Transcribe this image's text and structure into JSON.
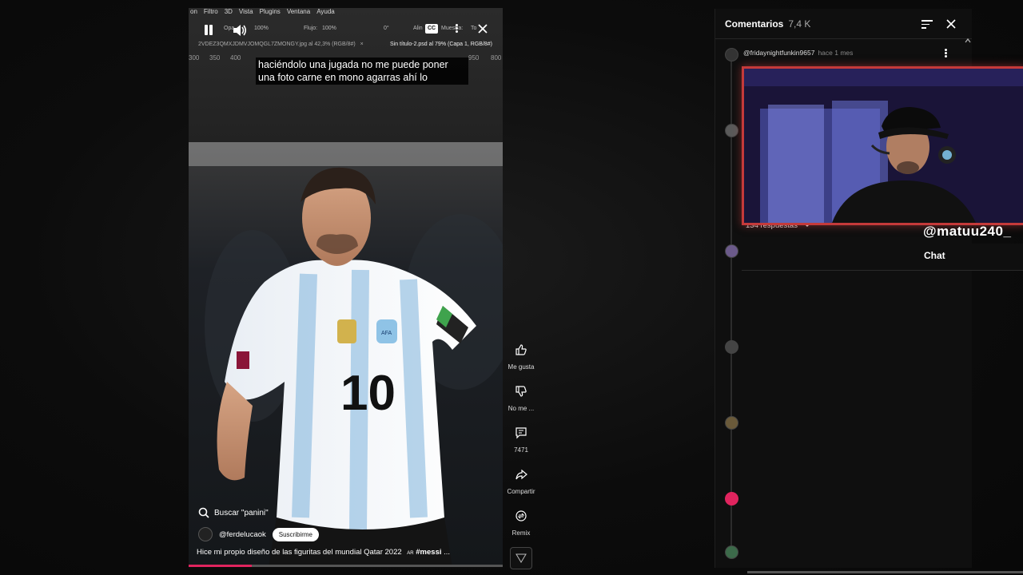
{
  "photoshop": {
    "menu": [
      "on",
      "Filtro",
      "3D",
      "Vista",
      "Plugins",
      "Ventana",
      "Ayuda"
    ],
    "tool_labels": [
      "Opa",
      "100%",
      "Flujo:",
      "100%",
      "0°",
      "Alin",
      "Muestra:",
      "To"
    ],
    "tab1": "2VDEZ3QMXJDMVJOMQGL7ZMONGY.jpg al 42,3% (RGB/8#)",
    "tab1_close": "×",
    "tab2": "Sin título-2.psd al 79% (Capa 1, RGB/8#)",
    "ruler": [
      "300",
      "350",
      "400",
      "950",
      "800"
    ]
  },
  "player": {
    "cc_label": "CC",
    "subtitle_line1": "haciéndolo una jugada no me puede poner",
    "subtitle_line2": "una foto carne en mono agarras ahí lo",
    "search_label": "Buscar \"panini\"",
    "channel": "@ferdelucaok",
    "subscribe": "Suscribirme",
    "caption_text": "Hice mi propio diseño de las figuritas del mundial Qatar 2022",
    "caption_ar": "AR",
    "caption_tag": "#messi",
    "caption_more": "...",
    "progress": 0.2,
    "jersey_number": "10",
    "photo_badge": "AFA"
  },
  "actions": {
    "like": "Me gusta",
    "dislike": "No me ...",
    "comments": "7471",
    "share": "Compartir",
    "remix": "Remix"
  },
  "comments": {
    "title": "Comentarios",
    "count": "7,4 K",
    "first_author": "@fridaynightfunkin9657",
    "first_time": "hace 1 mes",
    "replies": "134 respuestas"
  },
  "stream": {
    "handle": "@matuu240_",
    "chat_label": "Chat"
  },
  "colors": {
    "accent_red": "#e0245e",
    "webcam_border": "#c53a3a"
  }
}
